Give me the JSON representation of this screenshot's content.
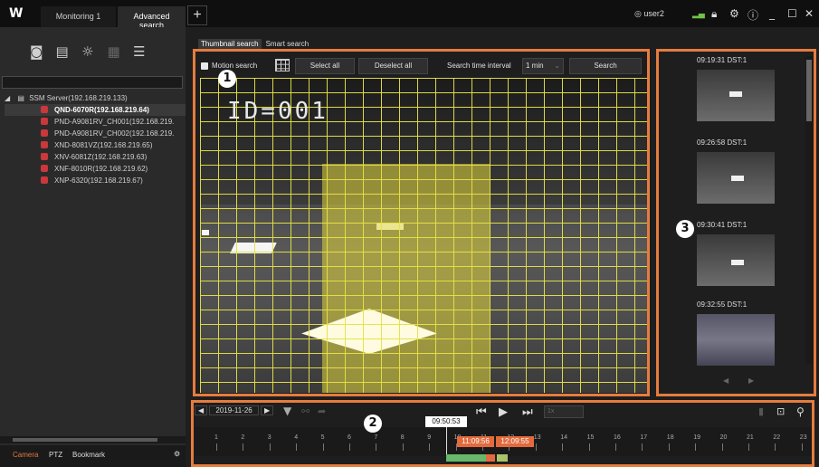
{
  "app": {
    "logo": "W"
  },
  "tabs": [
    {
      "label": "Monitoring 1"
    },
    {
      "label": "Advanced search"
    }
  ],
  "tab_add": "+",
  "user": {
    "name": "user2"
  },
  "top_icons": [
    "network-icon",
    "lock-icon",
    "settings-icon",
    "info-icon",
    "minimize-icon",
    "maximize-icon",
    "close-icon"
  ],
  "left": {
    "tool_icons": [
      "camera-icon",
      "recorder-icon",
      "alarm-icon",
      "layout-icon",
      "list-icon"
    ],
    "tree": {
      "server": "SSM Server(192.168.219.133)",
      "devices": [
        {
          "label": "QND-6070R(192.168.219.64)",
          "selected": true
        },
        {
          "label": "PND-A9081RV_CH001(192.168.219."
        },
        {
          "label": "PND-A9081RV_CH002(192.168.219."
        },
        {
          "label": "XND-8081VZ(192.168.219.65)"
        },
        {
          "label": "XNV-6081Z(192.168.219.63)"
        },
        {
          "label": "XNF-8010R(192.168.219.62)"
        },
        {
          "label": "XNP-6320(192.168.219.67)"
        }
      ]
    },
    "bottom_tabs": [
      {
        "label": "Camera",
        "active": true
      },
      {
        "label": "PTZ"
      },
      {
        "label": "Bookmark"
      }
    ]
  },
  "search": {
    "subtabs": [
      {
        "label": "Thumbnail search",
        "active": true
      },
      {
        "label": "Smart search"
      }
    ],
    "motion_search_label": "Motion search",
    "motion_search_checked": true,
    "select_all": "Select all",
    "deselect_all": "Deselect all",
    "interval_label": "Search time interval",
    "interval_value": "1 min",
    "search_button": "Search",
    "video_overlay": "ID=001"
  },
  "badges": {
    "video": "1",
    "timeline": "2",
    "results": "3"
  },
  "results": [
    {
      "time": "09:19:31 DST:1"
    },
    {
      "time": "09:26:58 DST:1"
    },
    {
      "time": "09:30:41 DST:1"
    },
    {
      "time": "09:32:55 DST:1"
    }
  ],
  "timeline": {
    "date": "2019-11-26",
    "current_time": "09:50:53",
    "speed": "1x",
    "hours": [
      "1",
      "2",
      "3",
      "4",
      "5",
      "6",
      "7",
      "8",
      "9",
      "10",
      "11",
      "12",
      "13",
      "14",
      "15",
      "16",
      "17",
      "18",
      "19",
      "20",
      "21",
      "22",
      "23"
    ],
    "range_start": "11:09:56",
    "range_end": "12:09:55",
    "colors": {
      "recorded": "#67b86a",
      "event": "#a9c46b",
      "range": "#e36a3c"
    }
  }
}
